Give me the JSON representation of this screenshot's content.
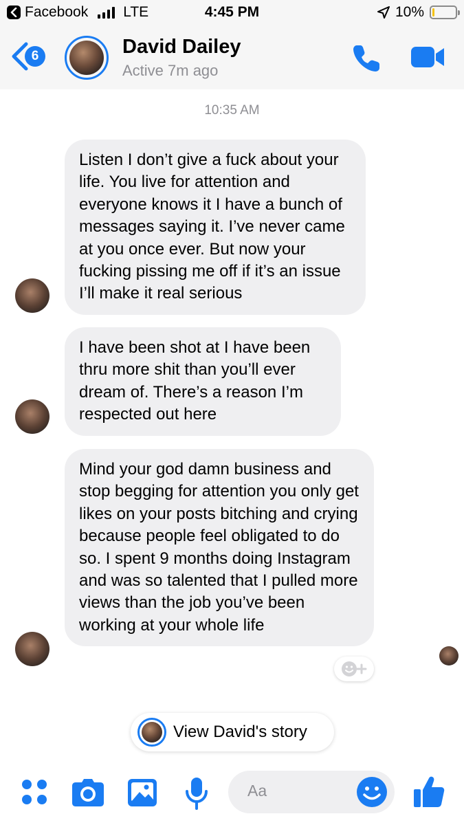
{
  "status_bar": {
    "back_app": "Facebook",
    "carrier": "LTE",
    "time": "4:45 PM",
    "battery": "10%",
    "battery_level": 0.1
  },
  "header": {
    "unread_count": "6",
    "contact_name": "David Dailey",
    "contact_status": "Active 7m ago"
  },
  "conversation": {
    "timestamp": "10:35 AM",
    "messages": [
      {
        "text": "Listen I don’t give a fuck about your life. You live for attention and everyone knows it I have a bunch of messages saying it. I’ve never came at you once ever. But now your fucking pissing me off if it’s an issue I’ll make it real serious"
      },
      {
        "text": "I have been shot at I have been thru more shit than you’ll ever dream of. There’s a reason I’m respected out here"
      },
      {
        "text": "Mind your god damn business and stop begging for attention you only get likes on your posts bitching and crying because people feel obligated to do so. I spent 9 months doing Instagram and was so talented that I pulled more views than the job you’ve been working at your whole life"
      }
    ]
  },
  "story_pill": {
    "label": "View David's story"
  },
  "composer": {
    "placeholder": "Aa"
  },
  "colors": {
    "accent": "#1a7cf2",
    "bubble": "#efeff1",
    "muted": "#8e8e93"
  }
}
